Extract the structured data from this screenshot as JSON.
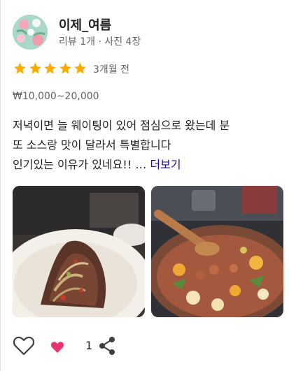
{
  "reviewer": {
    "name": "이제_여름",
    "meta": "리뷰 1개 · 사진 4장"
  },
  "rating": {
    "stars": 5,
    "star_color": "#f9ab00",
    "date": "3개월 전"
  },
  "price": "₩10,000~20,000",
  "review": {
    "lines": [
      "저녁이면 늘 웨이팅이 있어 점심으로 왔는데 분",
      "또 소스랑 맛이 달라서 특별합니다",
      "인기있는 이유가 있네요!! "
    ],
    "ellipsis": "…",
    "more_label": "더보기",
    "link_color": "#1a0dab"
  },
  "photos": [
    {
      "icon": "food-photo-icon"
    },
    {
      "icon": "food-photo-icon"
    }
  ],
  "actions": {
    "like_icon": "heart-outline-icon",
    "reaction_icon": "heart-filled-icon",
    "reaction_count": "1",
    "share_icon": "share-icon"
  }
}
